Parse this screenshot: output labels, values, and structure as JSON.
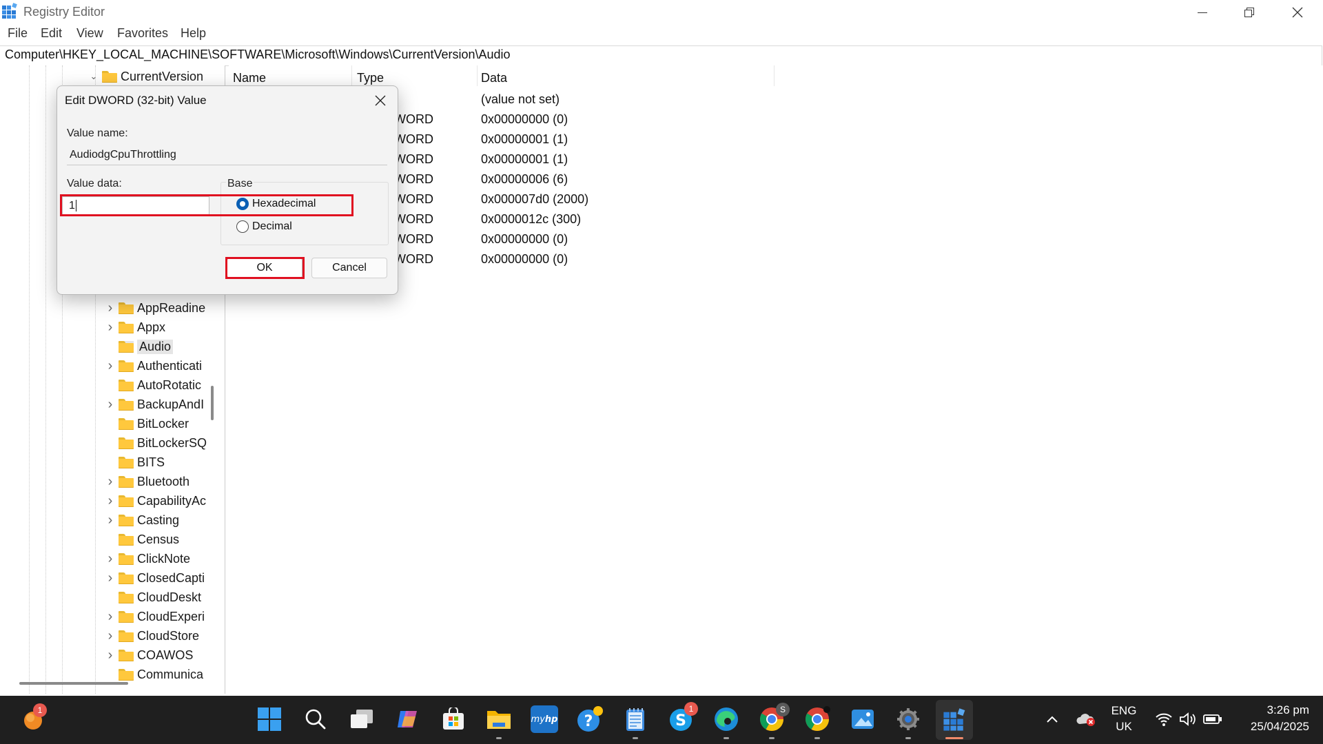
{
  "window": {
    "title": "Registry Editor",
    "controls": [
      "minimize",
      "restore",
      "close"
    ]
  },
  "menu": [
    "File",
    "Edit",
    "View",
    "Favorites",
    "Help"
  ],
  "address": "Computer\\HKEY_LOCAL_MACHINE\\SOFTWARE\\Microsoft\\Windows\\CurrentVersion\\Audio",
  "tree": {
    "parent": {
      "label": "CurrentVersion",
      "expanded": true
    },
    "items": [
      {
        "label": "AppReadine",
        "expandable": true
      },
      {
        "label": "Appx",
        "expandable": true
      },
      {
        "label": "Audio",
        "expandable": false,
        "selected": true
      },
      {
        "label": "Authenticati",
        "expandable": true
      },
      {
        "label": "AutoRotatic",
        "expandable": false
      },
      {
        "label": "BackupAndI",
        "expandable": true
      },
      {
        "label": "BitLocker",
        "expandable": false
      },
      {
        "label": "BitLockerSQ",
        "expandable": false
      },
      {
        "label": "BITS",
        "expandable": false
      },
      {
        "label": "Bluetooth",
        "expandable": true
      },
      {
        "label": "CapabilityAc",
        "expandable": true
      },
      {
        "label": "Casting",
        "expandable": true
      },
      {
        "label": "Census",
        "expandable": false
      },
      {
        "label": "ClickNote",
        "expandable": true
      },
      {
        "label": "ClosedCapti",
        "expandable": true
      },
      {
        "label": "CloudDeskt",
        "expandable": false
      },
      {
        "label": "CloudExperi",
        "expandable": true
      },
      {
        "label": "CloudStore",
        "expandable": true
      },
      {
        "label": "COAWOS",
        "expandable": true
      },
      {
        "label": "Communica",
        "expandable": false
      }
    ]
  },
  "list": {
    "columns": {
      "name": "Name",
      "type": "Type",
      "data": "Data"
    },
    "rows": [
      {
        "type": "",
        "data": "(value not set)"
      },
      {
        "type": "WORD",
        "data": "0x00000000 (0)"
      },
      {
        "type": "WORD",
        "data": "0x00000001 (1)"
      },
      {
        "type": "WORD",
        "data": "0x00000001 (1)"
      },
      {
        "type": "WORD",
        "data": "0x00000006 (6)"
      },
      {
        "type": "WORD",
        "data": "0x000007d0 (2000)"
      },
      {
        "type": "WORD",
        "data": "0x0000012c (300)"
      },
      {
        "type": "WORD",
        "data": "0x00000000 (0)"
      },
      {
        "type": "WORD",
        "data": "0x00000000 (0)"
      }
    ]
  },
  "dialog": {
    "title": "Edit DWORD (32-bit) Value",
    "value_name_label": "Value name:",
    "value_name": "AudiodgCpuThrottling",
    "value_data_label": "Value data:",
    "value_data": "1",
    "base_label": "Base",
    "hex_label": "Hexadecimal",
    "dec_label": "Decimal",
    "selected_base": "Hexadecimal",
    "ok_label": "OK",
    "cancel_label": "Cancel",
    "highlight_color": "#e01020"
  },
  "taskbar": {
    "notification_badge": "1",
    "skype_badge": "1",
    "chrome_badge": "S",
    "apps": [
      "windows-start",
      "search",
      "task-view",
      "copilot",
      "microsoft-store",
      "file-explorer",
      "myhp",
      "get-help",
      "notepad",
      "skype",
      "edge",
      "chrome",
      "chrome-profile",
      "paint",
      "settings",
      "registry-editor"
    ],
    "language": "ENG",
    "region": "UK",
    "time": "3:26 pm",
    "date": "25/04/2025"
  },
  "colors": {
    "accent": "#0a5fb4",
    "taskbar": "#1f1f1f",
    "folder": "#ffc83d"
  }
}
